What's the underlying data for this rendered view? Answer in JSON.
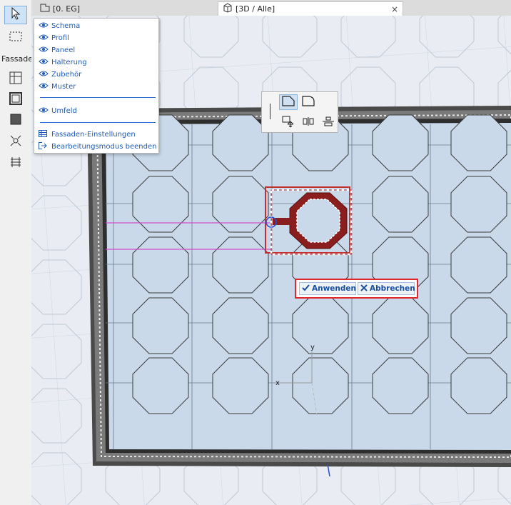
{
  "toolbox": {
    "palette_label": "Fassade",
    "tools": [
      "arrow-icon",
      "marquee-icon",
      "curtainwall-frame-icon",
      "curtainwall-panel-icon",
      "curtainwall-fill-icon",
      "curtainwall-junction-icon",
      "curtainwall-accessory-icon"
    ]
  },
  "tabs": {
    "plan": {
      "label": "[0. EG]"
    },
    "view3d": {
      "label": "[3D / Alle]",
      "close": "×"
    }
  },
  "visibility_menu": {
    "items": [
      {
        "label": "Schema",
        "icon": "eye-icon"
      },
      {
        "label": "Profil",
        "icon": "eye-icon"
      },
      {
        "label": "Paneel",
        "icon": "eye-icon"
      },
      {
        "label": "Halterung",
        "icon": "eye-icon"
      },
      {
        "label": "Zubehör",
        "icon": "eye-icon"
      },
      {
        "label": "Muster",
        "icon": "eye-icon"
      }
    ],
    "surrounding": {
      "label": "Umfeld",
      "icon": "eye-icon"
    },
    "settings": {
      "label": "Fassaden-Einstellungen",
      "icon": "settings-table-icon"
    },
    "exit": {
      "label": "Bearbeitungsmodus beenden",
      "icon": "exit-icon"
    }
  },
  "confirm_bar": {
    "apply_label": "Anwenden",
    "cancel_label": "Abbrechen"
  },
  "axes": {
    "x": "x",
    "y": "y"
  },
  "colors": {
    "accent": "#1e5bb8",
    "selection": "#b22222",
    "panel_fill": "#c8d8e8",
    "highlight_border": "#e0282c"
  }
}
